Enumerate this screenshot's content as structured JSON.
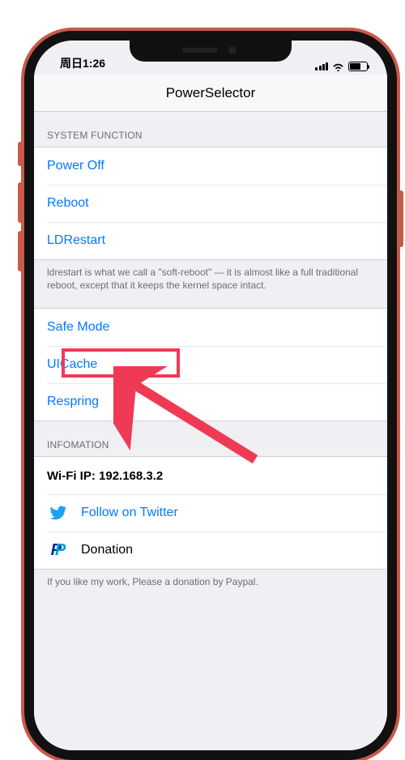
{
  "status": {
    "time": "周日1:26"
  },
  "nav": {
    "title": "PowerSelector"
  },
  "sections": {
    "system_function": {
      "header": "SYSTEM FUNCTION",
      "power_off": "Power Off",
      "reboot": "Reboot",
      "ldrestart": "LDRestart",
      "ldrestart_footer": "ldrestart is what we call a \"soft-reboot\" — it is almost like a full traditional reboot, except that it keeps the kernel space intact.",
      "safe_mode": "Safe Mode",
      "uicache": "UICache",
      "respring": "Respring"
    },
    "information": {
      "header": "INFOMATION",
      "wifi_ip": "Wi-Fi IP: 192.168.3.2",
      "twitter": "Follow on Twitter",
      "donation": "Donation",
      "donation_footer": "If you like my work, Please a donation by Paypal."
    }
  }
}
